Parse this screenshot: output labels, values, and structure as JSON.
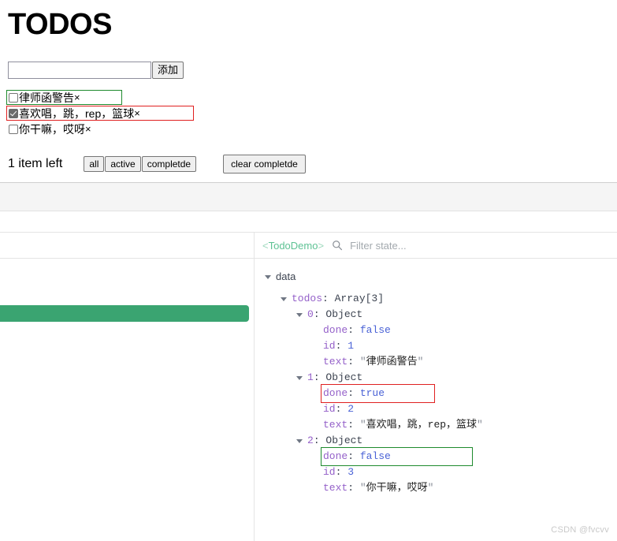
{
  "app": {
    "title": "TODOS",
    "add_form": {
      "input_value": "",
      "input_placeholder": "",
      "add_button_label": "添加"
    },
    "todos": [
      {
        "done": false,
        "text": "律师函警告",
        "remove_label": "×",
        "highlight": "green"
      },
      {
        "done": true,
        "text": "喜欢唱，跳，rep，篮球",
        "remove_label": "×",
        "highlight": "red"
      },
      {
        "done": false,
        "text": "你干嘛，哎呀",
        "remove_label": "×",
        "highlight": "none"
      }
    ],
    "footer": {
      "items_left": "1 item left",
      "filters": [
        "all",
        "active",
        "completde"
      ],
      "clear_label": "clear completde"
    }
  },
  "devtools": {
    "component_name_open": "<",
    "component_name": "TodoDemo",
    "component_name_close": ">",
    "search_icon": "search-icon",
    "filter_placeholder": "Filter state...",
    "tree": {
      "root_label": "data",
      "todos_key": "todos",
      "todos_type": "Array[3]",
      "items": [
        {
          "index": "0",
          "type": "Object",
          "fields": [
            {
              "key": "done",
              "value": "false",
              "kind": "bool",
              "highlight": "none"
            },
            {
              "key": "id",
              "value": "1",
              "kind": "num",
              "highlight": "none"
            },
            {
              "key": "text",
              "value": "律师函警告",
              "kind": "str",
              "highlight": "none"
            }
          ]
        },
        {
          "index": "1",
          "type": "Object",
          "fields": [
            {
              "key": "done",
              "value": "true",
              "kind": "bool",
              "highlight": "red"
            },
            {
              "key": "id",
              "value": "2",
              "kind": "num",
              "highlight": "none"
            },
            {
              "key": "text",
              "value": "喜欢唱，跳，rep，篮球",
              "kind": "str",
              "highlight": "none"
            }
          ]
        },
        {
          "index": "2",
          "type": "Object",
          "fields": [
            {
              "key": "done",
              "value": "false",
              "kind": "bool",
              "highlight": "green"
            },
            {
              "key": "id",
              "value": "3",
              "kind": "num",
              "highlight": "none"
            },
            {
              "key": "text",
              "value": "你干嘛，哎呀",
              "kind": "str",
              "highlight": "none"
            }
          ]
        }
      ]
    }
  },
  "watermark": "CSDN @fvcvv",
  "colors": {
    "accent_green": "#3aa471",
    "highlight_red": "#e02020",
    "highlight_green": "#1e8a2d",
    "component_green": "#5ec294",
    "key_purple": "#9460c9",
    "value_blue": "#4a62d6"
  }
}
